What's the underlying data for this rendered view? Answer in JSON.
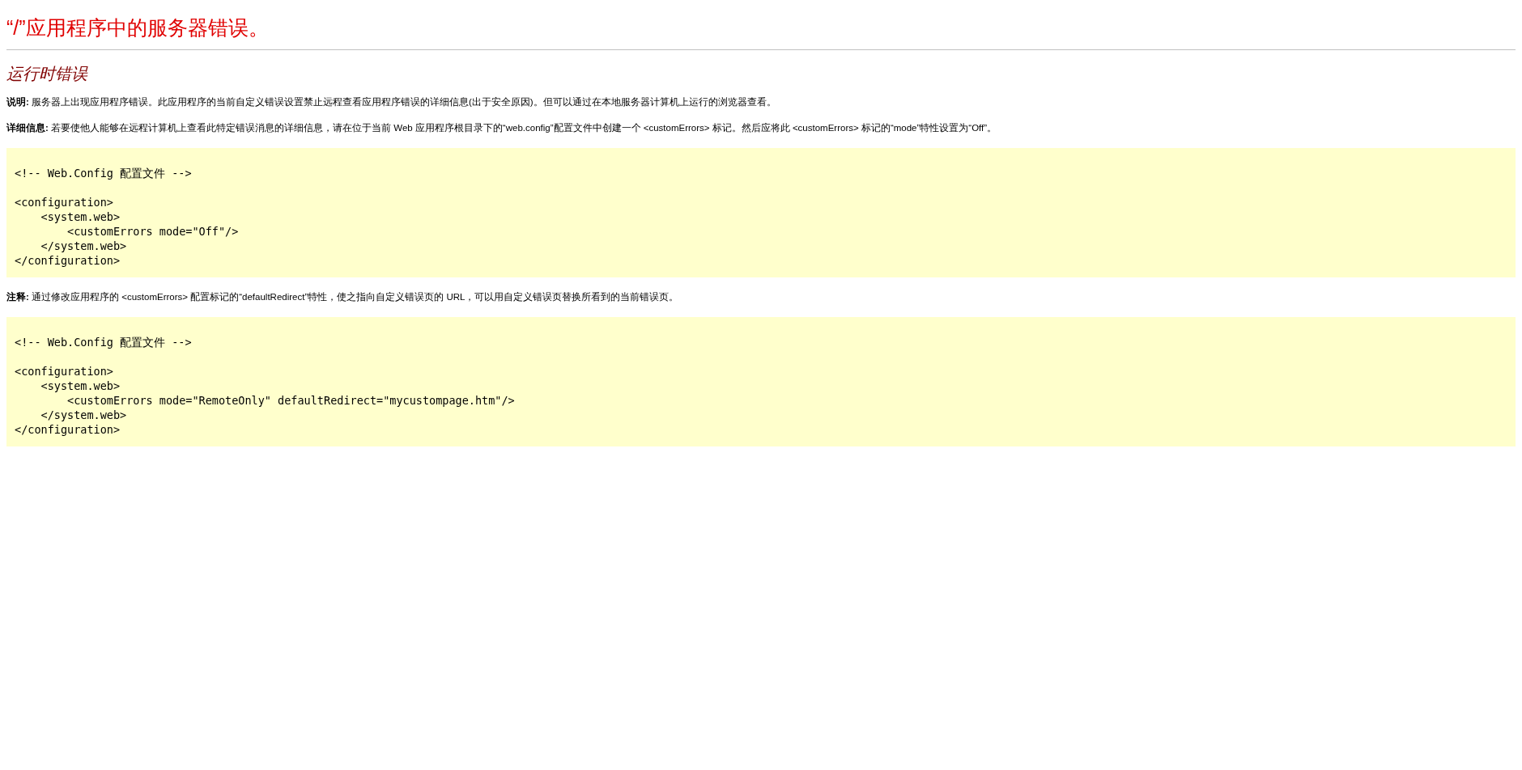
{
  "title": "“/”应用程序中的服务器错误。",
  "subtitle": "运行时错误",
  "description": "**说明:** 服务器上出现应用程序错误。此应用程序的当前自定义错误设置禁止远程查看应用程序错误的详细信息(出于安全原因)。但可以通过在本地服务器计算机上运行的浏览器查看。",
  "details": "**详细信息:** 若要使他人能够在远程计算机上查看此特定错误消息的详细信息，请在位于当前 Web 应用程序根目录下的“web.config”配置文件中创建一个 <customErrors> 标记。然后应将此 <customErrors> 标记的“mode”特性设置为“Off”。",
  "code_1": [
    "<!-- Web.Config 配置文件 -->",
    "<configuration>",
    "    <system.web>",
    "        <customErrors mode=\"Off\"/>",
    "    </system.web>",
    "</configuration>"
  ],
  "notes": "**注释:** 通过修改应用程序的 <customErrors> 配置标记的“defaultRedirect”特性，使之指向自定义错误页的 URL，可以用自定义错误页替换所看到的当前错误页。",
  "code_2": [
    "<!-- Web.Config 配置文件 -->",
    "<configuration>",
    "    <system.web>",
    "        <customErrors mode=\"RemoteOnly\" defaultRedirect=\"mycustompage.htm\"/>",
    "    </system.web>",
    "</configuration>"
  ]
}
